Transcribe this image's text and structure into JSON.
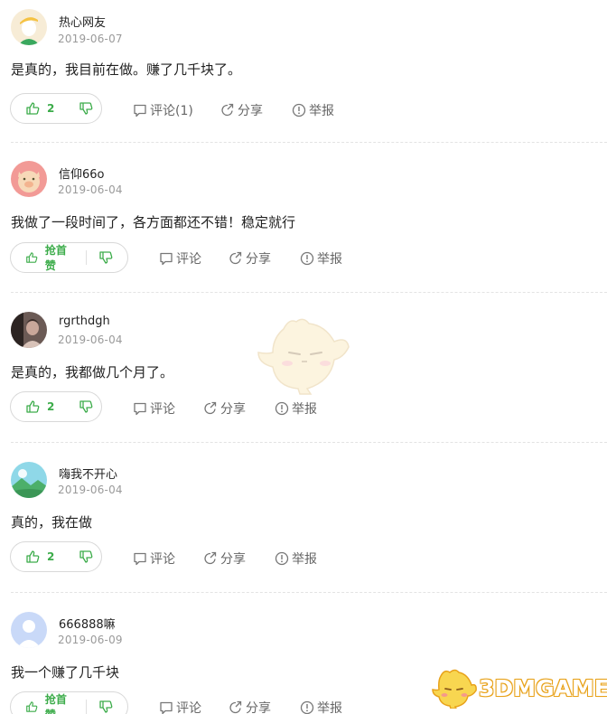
{
  "comments": [
    {
      "username": "热心网友",
      "date": "2019-06-07",
      "text": "是真的，我目前在做。赚了几千块了。",
      "vote_label": "2",
      "comment_label": "评论(1)",
      "share_label": "分享",
      "report_label": "举报"
    },
    {
      "username": "信仰66o",
      "date": "2019-06-04",
      "text": "我做了一段时间了，各方面都还不错！稳定就行",
      "vote_label": "抢首赞",
      "comment_label": "评论",
      "share_label": "分享",
      "report_label": "举报"
    },
    {
      "username": "rgrthdgh",
      "date": "2019-06-04",
      "text": "是真的，我都做几个月了。",
      "vote_label": "2",
      "comment_label": "评论",
      "share_label": "分享",
      "report_label": "举报"
    },
    {
      "username": "嗨我不开心",
      "date": "2019-06-04",
      "text": "真的，我在做",
      "vote_label": "2",
      "comment_label": "评论",
      "share_label": "分享",
      "report_label": "举报"
    },
    {
      "username": "666888嘛",
      "date": "2019-06-09",
      "text": "我一个赚了几千块",
      "vote_label": "抢首赞",
      "comment_label": "评论",
      "share_label": "分享",
      "report_label": "举报"
    }
  ],
  "watermark": {
    "text": "3DMGAME"
  },
  "colors": {
    "accent_green": "#3cac4a",
    "watermark_orange": "#e8a21a"
  }
}
